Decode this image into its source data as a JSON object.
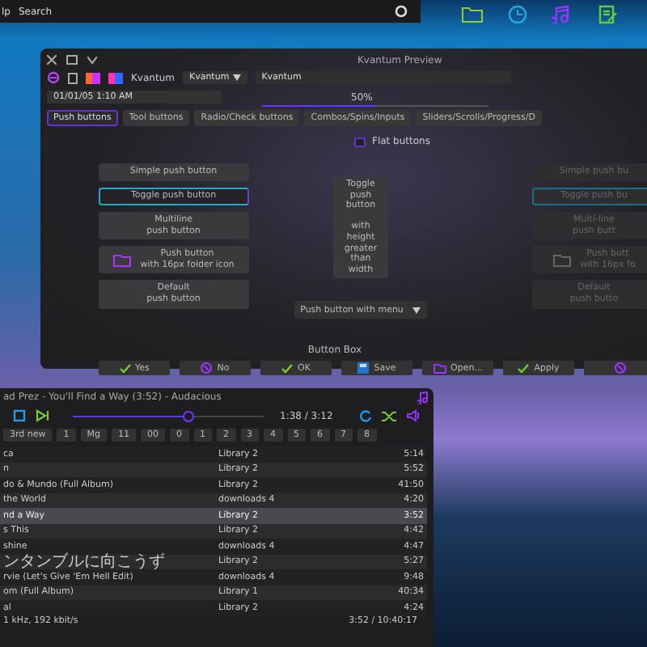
{
  "panel": {
    "launcher_text": "lp",
    "search_label": "Search"
  },
  "kvantum": {
    "title": "Kvantum Preview",
    "toolbar": {
      "label": "Kvantum",
      "combo": "Kvantum",
      "field": "Kvantum"
    },
    "date_combo": "01/01/05 1:10 AM",
    "progress": {
      "level": 0.5,
      "reading": "50%"
    },
    "tabs": [
      {
        "label": "Push buttons",
        "selected": true
      },
      {
        "label": "Tool buttons",
        "selected": false
      },
      {
        "label": "Radio/Check buttons",
        "selected": false
      },
      {
        "label": "Combos/Spins/Inputs",
        "selected": false
      },
      {
        "label": "Sliders/Scrolls/Progress/D",
        "selected": false
      }
    ],
    "flat_buttons": {
      "label": "Flat buttons",
      "checked": false
    },
    "left_buttons": [
      {
        "label": "Simple push button",
        "checked": false,
        "disabled": false,
        "icon": false
      },
      {
        "label": "Toggle push button",
        "checked": true,
        "disabled": false,
        "icon": false
      },
      {
        "label": "Multiline\npush button",
        "checked": false,
        "disabled": false,
        "icon": false
      },
      {
        "label": "Push button\nwith 16px folder icon",
        "checked": false,
        "disabled": false,
        "icon": true
      },
      {
        "label": "Default\npush button",
        "checked": false,
        "disabled": false,
        "icon": false
      }
    ],
    "tall_button": {
      "label": "Toggle\npush\nbutton\n\nwith\nheight\ngreater\nthan\nwidth",
      "checked": false
    },
    "right_buttons": [
      {
        "label": "Simple push bu",
        "checked": false,
        "disabled": true,
        "icon": false
      },
      {
        "label": "Toggle push bu",
        "checked": true,
        "disabled": true,
        "icon": false
      },
      {
        "label": "Multi-line\npush butt",
        "checked": false,
        "disabled": true,
        "icon": false
      },
      {
        "label": "Push butt\nwith 16px fo",
        "checked": false,
        "disabled": true,
        "icon": true
      },
      {
        "label": "Default\npush butto",
        "checked": false,
        "disabled": true,
        "icon": false
      }
    ],
    "menu_button": {
      "label": "Push button with menu"
    },
    "button_box": {
      "title": "Button Box",
      "buttons": [
        {
          "label": "Yes",
          "kind": "check"
        },
        {
          "label": "No",
          "kind": "cancel"
        },
        {
          "label": "OK",
          "kind": "check"
        },
        {
          "label": "Save",
          "kind": "save"
        },
        {
          "label": "Open...",
          "kind": "folder"
        },
        {
          "label": "Apply",
          "kind": "check"
        },
        {
          "kind": "cancel"
        }
      ]
    }
  },
  "audacious": {
    "title": "ad Prez - You'll Find a Way (3:52) - Audacious",
    "seek": {
      "level": 0.6
    },
    "time": "1:38 / 3:12",
    "playlists": [
      {
        "label": "3rd new",
        "selected": false
      },
      {
        "label": "1",
        "selected": false
      },
      {
        "label": "Mg",
        "selected": false
      },
      {
        "label": "11",
        "selected": false
      },
      {
        "label": "00",
        "selected": false
      },
      {
        "label": "0",
        "selected": false
      },
      {
        "label": "1",
        "selected": false
      },
      {
        "label": "2",
        "selected": false
      },
      {
        "label": "3",
        "selected": false
      },
      {
        "label": "4",
        "selected": false
      },
      {
        "label": "5",
        "selected": false
      },
      {
        "label": "6",
        "selected": false
      },
      {
        "label": "7",
        "selected": false
      },
      {
        "label": "8",
        "selected": false
      }
    ],
    "rows": [
      {
        "title": "ca",
        "album": "Library 2",
        "length": "5:14",
        "selected": false
      },
      {
        "title": "n",
        "album": "Library 2",
        "length": "5:52",
        "selected": false
      },
      {
        "title": "do & Mundo (Full Album)",
        "album": "Library 2",
        "length": "41:50",
        "selected": false
      },
      {
        "title": "the World",
        "album": "downloads 4",
        "length": "4:20",
        "selected": false
      },
      {
        "title": "nd a Way",
        "album": "Library 2",
        "length": "3:52",
        "selected": true
      },
      {
        "title": "s This",
        "album": "Library 2",
        "length": "4:42",
        "selected": false
      },
      {
        "title": "shine",
        "album": "downloads 4",
        "length": "4:47",
        "selected": false
      },
      {
        "title": "ンタンブルに向こうず",
        "album": "Library 2",
        "length": "5:27",
        "selected": false,
        "kind": "cjk"
      },
      {
        "title": "rvie (Let's Give 'Em Hell Edit)",
        "album": "downloads 4",
        "length": "9:48",
        "selected": false
      },
      {
        "title": "om (Full Album)",
        "album": "Library 1",
        "length": "40:34",
        "selected": false
      },
      {
        "title": "al",
        "album": "Library 2",
        "length": "4:24",
        "selected": false
      }
    ],
    "status_left": "1 kHz, 192 kbit/s",
    "status_right": "3:52 / 10:40:17"
  }
}
